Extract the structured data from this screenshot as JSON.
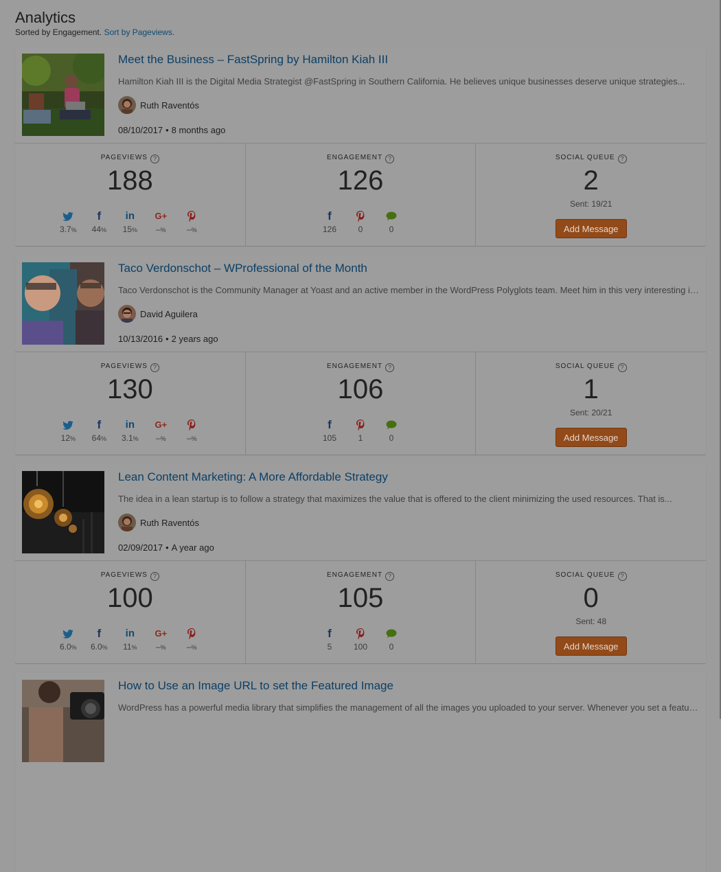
{
  "page": {
    "title": "Analytics",
    "sort_prefix": "Sorted by",
    "sort_current": "Engagement.",
    "sort_link": "Sort by Pageviews."
  },
  "labels": {
    "pageviews": "PAGEVIEWS",
    "engagement": "ENGAGEMENT",
    "social_queue": "SOCIAL QUEUE",
    "help": "?",
    "add_message": "Add Message",
    "bullet": "•",
    "pct": "%"
  },
  "colors": {
    "twitter": "#1c5e8b",
    "facebook": "#1d3560",
    "linkedin": "#0f4a74",
    "google_plus": "#8a2a1e",
    "pinterest": "#8a1a1a",
    "comments": "#46700f",
    "button": "#924a19",
    "link": "#0c3f65"
  },
  "posts": [
    {
      "title": "Meet the Business – FastSpring by Hamilton Kiah III",
      "excerpt": "Hamilton Kiah III is the Digital Media Strategist @FastSpring in Southern California. He believes unique businesses deserve unique strategies...",
      "author": "Ruth Raventós",
      "date": "08/10/2017",
      "ago": "8 months ago",
      "pageviews": "188",
      "engagement": "126",
      "queue": "2",
      "sent": "Sent: 19/21",
      "shares": {
        "twitter": "3.7",
        "facebook": "44",
        "linkedin": "15",
        "google_plus": "–",
        "pinterest": "–"
      },
      "engagement_breakdown": {
        "facebook": "126",
        "pinterest": "0",
        "comments": "0"
      }
    },
    {
      "title": "Taco Verdonschot – WProfessional of the Month",
      "excerpt": "Taco Verdonschot is the Community Manager at Yoast and an active member in the WordPress Polyglots team. Meet him in this very interesting interview...",
      "author": "David Aguilera",
      "date": "10/13/2016",
      "ago": "2 years ago",
      "pageviews": "130",
      "engagement": "106",
      "queue": "1",
      "sent": "Sent: 20/21",
      "shares": {
        "twitter": "12",
        "facebook": "64",
        "linkedin": "3.1",
        "google_plus": "–",
        "pinterest": "–"
      },
      "engagement_breakdown": {
        "facebook": "105",
        "pinterest": "1",
        "comments": "0"
      }
    },
    {
      "title": "Lean Content Marketing: A More Affordable Strategy",
      "excerpt": "The idea in a lean startup is to follow a strategy that maximizes the value that is offered to the client minimizing the used resources. That is...",
      "author": "Ruth Raventós",
      "date": "02/09/2017",
      "ago": "A year ago",
      "pageviews": "100",
      "engagement": "105",
      "queue": "0",
      "sent": "Sent: 48",
      "shares": {
        "twitter": "6.0",
        "facebook": "6.0",
        "linkedin": "11",
        "google_plus": "–",
        "pinterest": "–"
      },
      "engagement_breakdown": {
        "facebook": "5",
        "pinterest": "100",
        "comments": "0"
      }
    },
    {
      "title": "How to Use an Image URL to set the Featured Image",
      "excerpt": "WordPress has a powerful media library that simplifies the management of all the images you uploaded to your server. Whenever you set a featured image..."
    }
  ]
}
